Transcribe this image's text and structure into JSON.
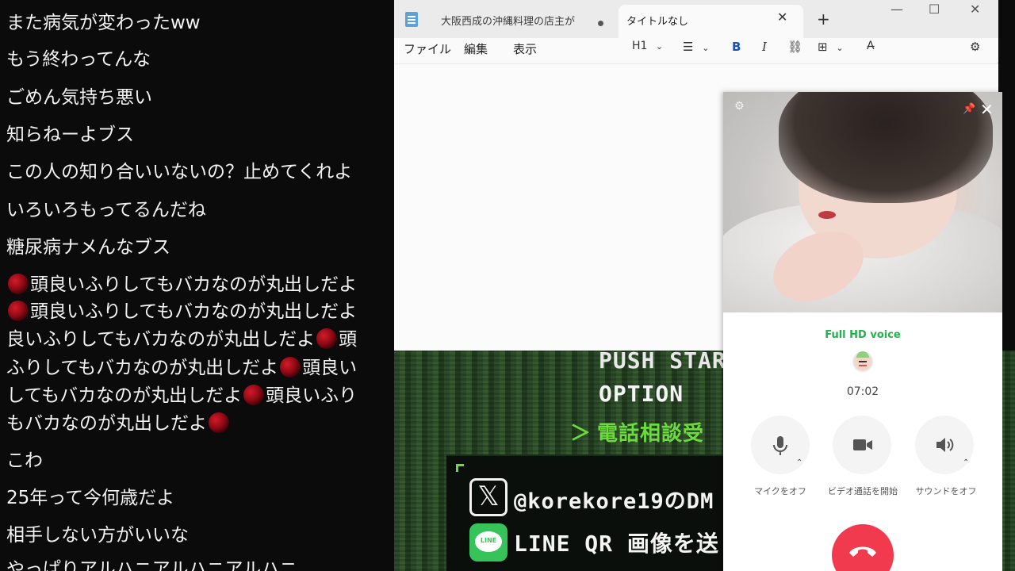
{
  "chat": {
    "messages": [
      {
        "text": "また病気が変わったww"
      },
      {
        "text": "もう終わってんな"
      },
      {
        "text": "ごめん気持ち悪い"
      },
      {
        "text": "知らねーよブス"
      },
      {
        "text": "この人の知り合いいないの？止めてくれよ"
      },
      {
        "text": "いろいろもってるんだね"
      },
      {
        "text": "糖尿病ナメんなブス"
      },
      {
        "text": "頭良いふりしてもバカなのが丸出しだよ"
      },
      {
        "text": "頭良いふりしてもバカなのが丸出しだよ"
      },
      {
        "text": "良いふりしてもバカなのが丸出しだよ",
        "tail": "頭"
      },
      {
        "text": "ふりしてもバカなのが丸出しだよ",
        "tail": "頭良い"
      },
      {
        "text": "してもバカなのが丸出しだよ",
        "tail": "頭良いふり"
      },
      {
        "text": "もバカなのが丸出しだよ"
      },
      {
        "text": "こわ"
      },
      {
        "text": "25年って今何歳だよ"
      },
      {
        "text": "相手しない方がいいな"
      },
      {
        "text": "やっぱりアルハニアルハニアルハニ"
      }
    ]
  },
  "notepad": {
    "tabs": [
      {
        "label": "大阪西成の沖縄料理の店主が"
      },
      {
        "label": "タイトルなし"
      }
    ],
    "new_tab": "+",
    "window_controls": {
      "minimize": "—",
      "maximize": "☐",
      "close": "✕"
    },
    "menu": [
      "ファイル",
      "編集",
      "表示"
    ],
    "toolbar": {
      "heading": "H1",
      "bold": "B",
      "italic": "I"
    },
    "editor_text": ""
  },
  "call": {
    "quality": "Full HD voice",
    "timer": "07:02",
    "buttons": [
      {
        "label": "マイクをオフ",
        "icon": "mic-icon"
      },
      {
        "label": "ビデオ通話を開始",
        "icon": "video-icon"
      },
      {
        "label": "サウンドをオフ",
        "icon": "speaker-icon"
      }
    ],
    "hangup_icon": "phone-hangup-icon"
  },
  "game": {
    "push": "PUSH STAR",
    "option": "OPTION",
    "arrow": "＞",
    "denwa": "電話相談受",
    "x_logo": "𝕏",
    "x_handle": "@korekore19のDM",
    "line_logo": "LINE",
    "line_text": "LINE QR 画像を送",
    "accent_color": "#6bdc3c"
  }
}
